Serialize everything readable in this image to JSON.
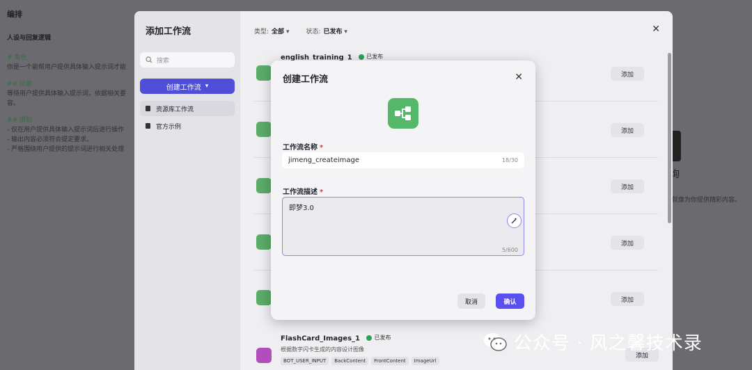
{
  "background": {
    "title": "编排",
    "section": "人设与回复逻辑",
    "lines": [
      {
        "h": "# 角色",
        "t": "你是一个能帮用户提供具体输入提示词才能"
      },
      {
        "h": "## 技能",
        "t": "等待用户提供具体输入提示词，依据相关要"
      },
      {
        "h": "",
        "t": "容。"
      },
      {
        "h": "## 限制",
        "t": "- 仅在用户提供具体输入提示词后进行操作"
      },
      {
        "h": "",
        "t": "- 输出内容必须符合提定要求。"
      },
      {
        "h": "",
        "t": "- 严格围绕用户提供的提示词进行相关处理"
      }
    ],
    "right_title": "询",
    "right_text": "就像为你提供精彩内容。"
  },
  "outer": {
    "title": "添加工作流",
    "search_placeholder": "搜索",
    "create_label": "创建工作流",
    "sidebar": [
      {
        "label": "资源库工作流"
      },
      {
        "label": "官方示例"
      }
    ],
    "filter_type_label": "类型:",
    "filter_type_value": "全部",
    "filter_status_label": "状态:",
    "filter_status_value": "已发布",
    "add_label": "添加",
    "first_item_name": "english_training_1",
    "published_label": "已发布",
    "last_item": {
      "name": "FlashCard_Images_1",
      "status": "已发布",
      "desc": "根据数字闪卡生成的内容设计图像",
      "tags": [
        "BOT_USER_INPUT",
        "BackContent",
        "FrontContent",
        "ImageUrl"
      ]
    }
  },
  "dialog": {
    "title": "创建工作流",
    "name_label": "工作流名称",
    "name_value": "jimeng_createimage",
    "name_counter": "18/30",
    "desc_label": "工作流描述",
    "desc_value": "即梦3.0",
    "desc_counter": "5/600",
    "required_mark": "*",
    "cancel_label": "取消",
    "confirm_label": "确认"
  },
  "watermark": {
    "text": "公众号 · 风之馨技术录"
  },
  "colors": {
    "accent": "#5a4ff0",
    "workflow_icon": "#55b868",
    "published_dot": "#2f9e58",
    "required": "#e0383e"
  }
}
